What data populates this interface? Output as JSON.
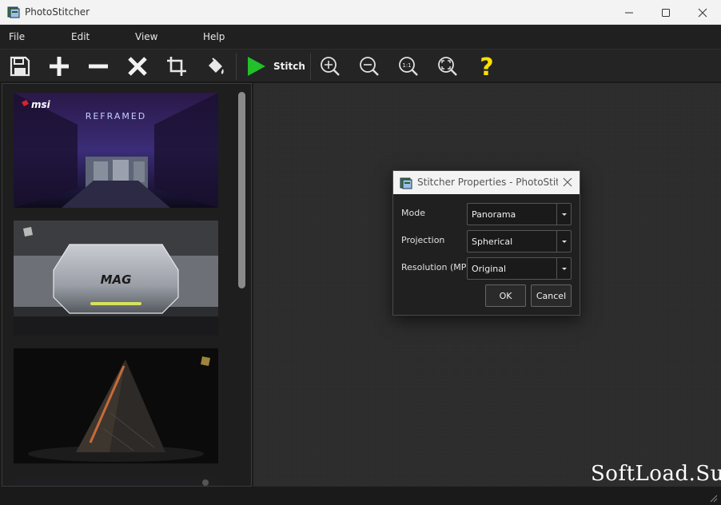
{
  "window": {
    "title": "PhotoStitcher"
  },
  "menu": {
    "items": [
      "File",
      "Edit",
      "View",
      "Help"
    ]
  },
  "toolbar": {
    "stitch_label": "Stitch",
    "buttons": [
      "save-icon",
      "add-icon",
      "remove-icon",
      "delete-icon",
      "crop-icon",
      "fill-icon",
      "zoom-in-icon",
      "zoom-out-icon",
      "zoom-actual-icon",
      "zoom-fit-icon",
      "help-icon"
    ],
    "zoom_actual_text": "1:1",
    "help_text": "?"
  },
  "thumbnails": [
    {
      "logo": "msi",
      "caption": "REFRAMED"
    },
    {
      "logo": "MAG"
    },
    {
      "logo": "msi-dragon"
    },
    {
      "logo": ""
    }
  ],
  "dialog": {
    "title": "Stitcher Properties - PhotoStitcher",
    "fields": [
      {
        "label": "Mode",
        "value": "Panorama"
      },
      {
        "label": "Projection",
        "value": "Spherical"
      },
      {
        "label": "Resolution (MP)",
        "value": "Original"
      }
    ],
    "ok_label": "OK",
    "cancel_label": "Cancel"
  },
  "watermark": "SoftLoad.Su",
  "colors": {
    "stitch_green": "#22c02a",
    "help_yellow": "#ffe000",
    "accent_red": "#d8222c"
  }
}
